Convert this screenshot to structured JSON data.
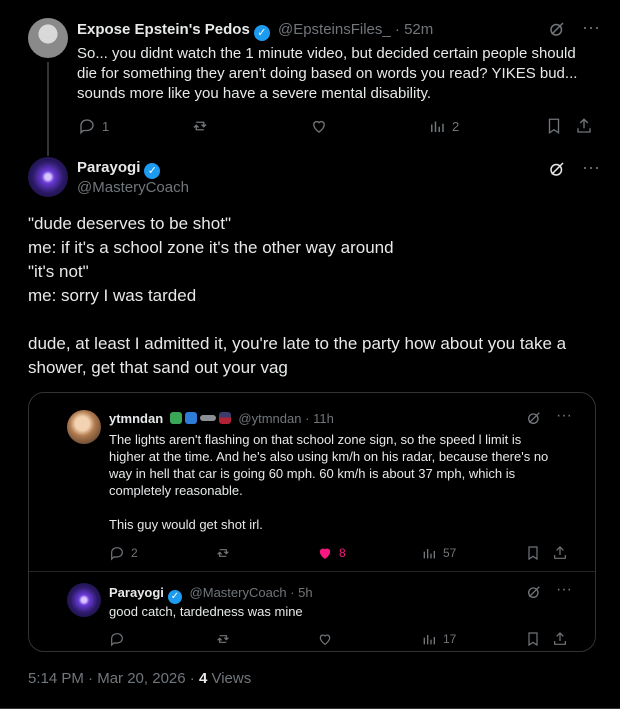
{
  "tweet1": {
    "name": "Expose Epstein's Pedos",
    "handle": "@EpsteinsFiles_",
    "dot": "·",
    "time": "52m",
    "text_lines": [
      "So... you didnt watch the 1 minute video, but decided certain people should",
      "die for something they aren't doing based on words you read? YIKES bud...",
      "sounds more like you have a severe mental disability."
    ],
    "actions": {
      "replies": "1",
      "views": "2"
    }
  },
  "tweet2": {
    "name": "Parayogi",
    "handle": "@MasteryCoach",
    "lines": [
      "\"dude deserves to be shot\"",
      "me: if it's a school zone it's the other way around",
      "\"it's not\"",
      "me: sorry I was tarded",
      "",
      "dude, at least I admitted it, you're late to the party how about you take a",
      "shower, get that sand out your vag"
    ]
  },
  "embed": {
    "post1": {
      "name": "ytmndan",
      "handle": "@ytmndan",
      "dot": "·",
      "time": "11h",
      "text_lines": [
        "The lights aren't flashing on that school zone sign, so the speed l limit is",
        "higher at the time. And he's also using km/h on his radar, because there's no",
        "way in hell that car is going 60 mph. 60 km/h is about 37 mph, which is",
        "completely reasonable.",
        "",
        "This guy would get shot irl."
      ],
      "actions": {
        "replies": "2",
        "likes": "8",
        "views": "57"
      }
    },
    "post2": {
      "name": "Parayogi",
      "handle": "@MasteryCoach",
      "dot": "·",
      "time": "5h",
      "text": "good catch, tardedness was mine",
      "actions": {
        "views": "17"
      }
    }
  },
  "meta": {
    "time": "5:14 PM",
    "dot": "·",
    "date": "Mar 20, 2026",
    "views_count": "4",
    "views_label": "Views"
  },
  "colors": {
    "accent": "#1d9bf0",
    "like": "#f91880",
    "muted": "#71767b",
    "border": "#2f3336"
  }
}
